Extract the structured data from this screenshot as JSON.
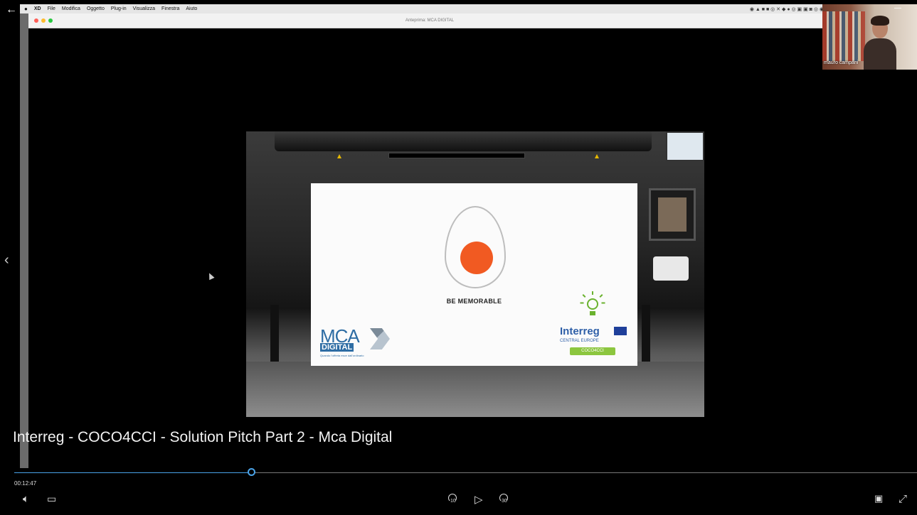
{
  "menubar": {
    "apple": "",
    "items": [
      "XD",
      "File",
      "Modifica",
      "Oggetto",
      "Plug-in",
      "Visualizza",
      "Finestra",
      "Aiuto"
    ]
  },
  "window": {
    "title": "Anteprima: MCA DIGITAL"
  },
  "webcam": {
    "name": "mauro campani"
  },
  "slide": {
    "tagline": "BE MEMORABLE",
    "mca_word": "MCA",
    "mca_digital": "DIGITAL",
    "mca_slogan": "Quando l'offerta esce dall'ordinario",
    "interreg_brand": "Interreg",
    "interreg_sub": "CENTRAL EUROPE",
    "interreg_project": "COCO4CCI"
  },
  "player": {
    "title": "Interreg - COCO4CCI - Solution Pitch Part 2 - Mca Digital",
    "timecode": "00:12:47",
    "progress_fraction": 0.263,
    "skip_back_label": "10",
    "skip_forward_label": "30"
  },
  "colors": {
    "accent": "#4aa3e8",
    "egg_yolk": "#f15a22",
    "mca_blue": "#2e6da4",
    "interreg_green": "#8cc63f"
  },
  "icons": {
    "back": "back-arrow-icon",
    "prev": "chevron-left-icon",
    "volume": "volume-icon",
    "subtitles": "subtitles-icon",
    "play": "play-icon",
    "miniplayer": "miniplayer-icon",
    "fullscreen": "fullscreen-icon"
  }
}
